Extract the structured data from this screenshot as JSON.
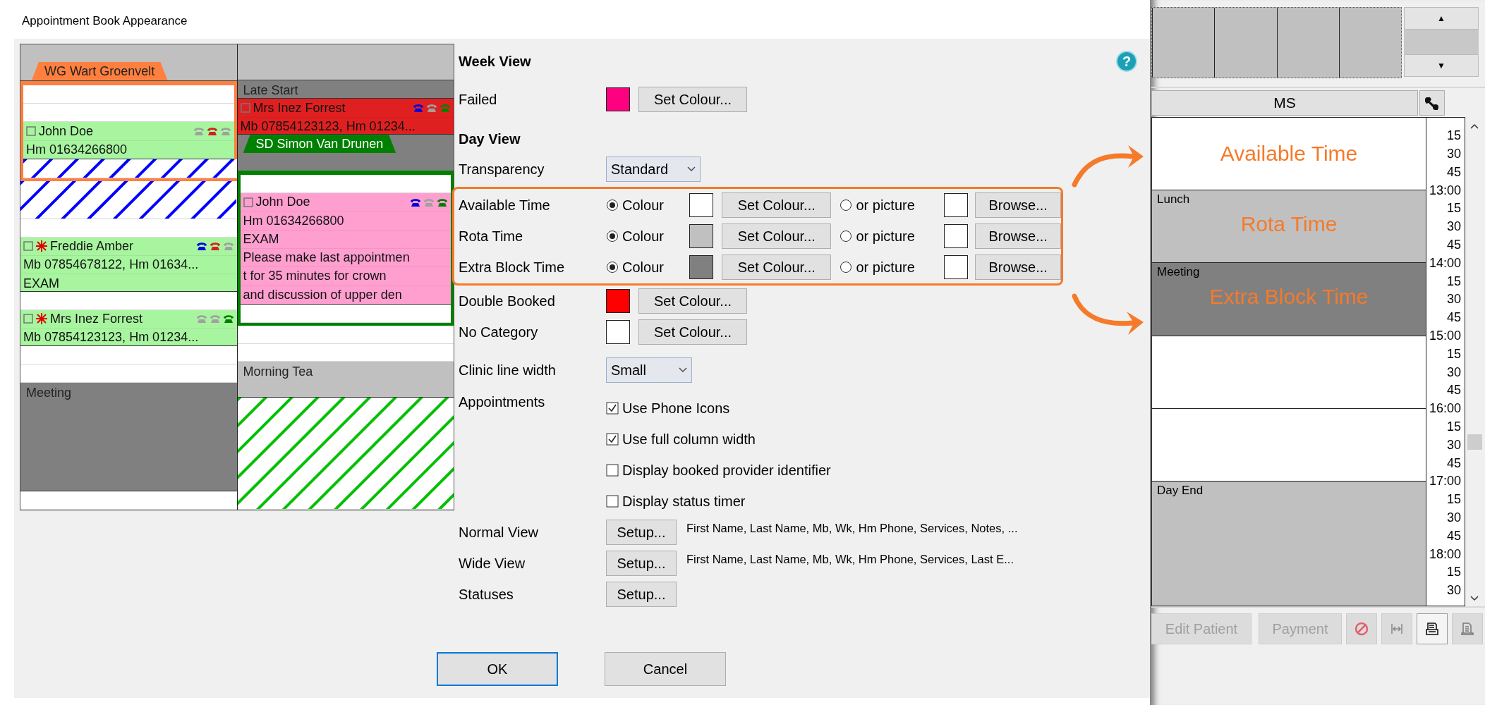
{
  "window": {
    "title": "Appointment Book Appearance"
  },
  "preview": {
    "columns": [
      {
        "blocks": [
          {
            "kind": "header",
            "tab": {
              "label": "WG Wart Groenvelt",
              "color": "#ff7f3f"
            }
          },
          {
            "kind": "frame",
            "color": "#ff7f3f",
            "blocks": [
              {
                "kind": "empty"
              },
              {
                "kind": "appointment",
                "color": "#a8f5a0",
                "name": "John Doe",
                "flagged": false,
                "phones": [
                  {
                    "color": "#a0a0a0"
                  },
                  {
                    "color": "#d02020"
                  },
                  {
                    "color": "#a0a0a0"
                  }
                ],
                "lines": [
                  "Hm 01634266800"
                ]
              },
              {
                "kind": "hatch",
                "color": "#0000ff"
              }
            ]
          },
          {
            "kind": "hatch",
            "color": "#0000ff"
          },
          {
            "kind": "empty"
          },
          {
            "kind": "appointment",
            "color": "#a8f5a0",
            "name": "Freddie Amber",
            "flagged": true,
            "phones": [
              {
                "color": "#0000e0"
              },
              {
                "color": "#d02020"
              },
              {
                "color": "#a0a0a0"
              }
            ],
            "lines": [
              "Mb 07854678122, Hm 01634...",
              "EXAM"
            ]
          },
          {
            "kind": "empty"
          },
          {
            "kind": "appointment",
            "color": "#a8f5a0",
            "name": "Mrs Inez Forrest",
            "flagged": true,
            "phones": [
              {
                "color": "#a0a0a0"
              },
              {
                "color": "#a0a0a0"
              },
              {
                "color": "#008000"
              }
            ],
            "lines": [
              "Mb 07854123123, Hm 01234..."
            ]
          },
          {
            "kind": "empty"
          },
          {
            "kind": "extra",
            "label": "Meeting"
          },
          {
            "kind": "empty"
          }
        ]
      },
      {
        "blocks": [
          {
            "kind": "header"
          },
          {
            "kind": "extra",
            "label": "Late Start"
          },
          {
            "kind": "appointment",
            "color": "#e02020",
            "name": "Mrs Inez Forrest",
            "flagged": false,
            "phones": [
              {
                "color": "#0000e0"
              },
              {
                "color": "#a0a0a0"
              },
              {
                "color": "#008000"
              }
            ],
            "lines": [
              "Mb 07854123123, Hm 01234..."
            ]
          },
          {
            "kind": "tab",
            "label": "SD Simon Van Drunen",
            "color": "#008000"
          },
          {
            "kind": "frame",
            "color": "#008000",
            "blocks": [
              {
                "kind": "empty"
              },
              {
                "kind": "appointment",
                "color": "#ff9fd0",
                "name": "John Doe",
                "flagged": false,
                "phones": [
                  {
                    "color": "#0000e0"
                  },
                  {
                    "color": "#a0a0a0"
                  },
                  {
                    "color": "#008000"
                  }
                ],
                "lines": [
                  "Hm 01634266800",
                  "EXAM",
                  "Please make last appointmen",
                  "t for 35 minutes for crown",
                  "and discussion of upper den"
                ]
              },
              {
                "kind": "empty"
              }
            ]
          },
          {
            "kind": "empty"
          },
          {
            "kind": "rota",
            "label": "Morning Tea"
          },
          {
            "kind": "hatch",
            "color": "#00c000"
          }
        ]
      }
    ]
  },
  "settings": {
    "help": "?",
    "week_view": {
      "heading": "Week View",
      "rows": [
        {
          "label": "Failed",
          "color": "#ff0080",
          "button": "Set Colour..."
        }
      ]
    },
    "day_view": {
      "heading": "Day View",
      "transparency": {
        "label": "Transparency",
        "value": "Standard"
      },
      "time_rows": [
        {
          "label": "Available Time",
          "options": [
            {
              "label": "Colour",
              "selected": true
            },
            {
              "label": "or picture",
              "selected": false
            }
          ],
          "color": "#ffffff",
          "button": "Set Colour...",
          "browse": "Browse..."
        },
        {
          "label": "Rota Time",
          "options": [
            {
              "label": "Colour",
              "selected": true
            },
            {
              "label": "or picture",
              "selected": false
            }
          ],
          "color": "#c0c0c0",
          "button": "Set Colour...",
          "browse": "Browse..."
        },
        {
          "label": "Extra Block Time",
          "options": [
            {
              "label": "Colour",
              "selected": true
            },
            {
              "label": "or picture",
              "selected": false
            }
          ],
          "color": "#808080",
          "button": "Set Colour...",
          "browse": "Browse..."
        }
      ],
      "colour_rows": [
        {
          "label": "Double Booked",
          "color": "#ff0000",
          "button": "Set Colour..."
        },
        {
          "label": "No Category",
          "color": "#ffffff",
          "button": "Set Colour..."
        }
      ],
      "clinic_line_width": {
        "label": "Clinic line width",
        "value": "Small"
      },
      "appointments": {
        "label": "Appointments",
        "options": [
          {
            "label": "Use Phone Icons",
            "checked": true
          },
          {
            "label": "Use full column width",
            "checked": true
          },
          {
            "label": "Display booked provider identifier",
            "checked": false
          },
          {
            "label": "Display status timer",
            "checked": false
          }
        ]
      },
      "views": [
        {
          "label": "Normal View",
          "button": "Setup...",
          "summary": "First Name, Last Name, Mb, Wk, Hm Phone, Services, Notes, ..."
        },
        {
          "label": "Wide View",
          "button": "Setup...",
          "summary": "First Name, Last Name, Mb, Wk, Hm Phone, Services, Last E..."
        },
        {
          "label": "Statuses",
          "button": "Setup..."
        }
      ]
    },
    "buttons": [
      "OK",
      "Cancel"
    ]
  },
  "book": {
    "scroll_up": "▲",
    "scroll_down": "▼",
    "column": "MS",
    "blocks": [
      {
        "kind": "available",
        "annotation": "Available Time"
      },
      {
        "kind": "rota",
        "label": "Lunch",
        "annotation": "Rota Time"
      },
      {
        "kind": "extra",
        "label": "Meeting",
        "annotation": "Extra Block Time"
      },
      {
        "kind": "available"
      },
      {
        "kind": "available"
      },
      {
        "kind": "rota",
        "label": "Day End"
      }
    ],
    "times": [
      "15",
      "30",
      "45",
      "13:00",
      "15",
      "30",
      "45",
      "14:00",
      "15",
      "30",
      "45",
      "15:00",
      "15",
      "30",
      "45",
      "16:00",
      "15",
      "30",
      "45",
      "17:00",
      "15",
      "30",
      "45",
      "18:00",
      "15",
      "30"
    ],
    "buttons": [
      {
        "label": "Edit Patient",
        "disabled": true
      },
      {
        "label": "Payment",
        "disabled": true
      }
    ],
    "tools": [
      {
        "kind": "no-entry"
      },
      {
        "kind": "split"
      },
      {
        "kind": "receipt"
      },
      {
        "kind": "document"
      }
    ]
  }
}
